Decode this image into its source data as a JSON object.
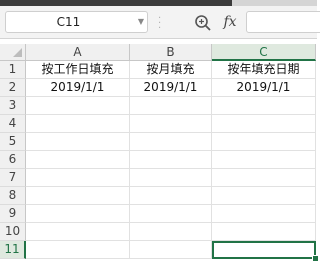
{
  "formula_bar": {
    "name_box": "C11",
    "fx_label": "fx",
    "formula_value": ""
  },
  "columns": [
    "A",
    "B",
    "C"
  ],
  "active_column": "C",
  "active_row": 11,
  "rows": [
    {
      "num": "1",
      "cells": [
        "按工作日填充",
        "按月填充",
        "按年填充日期"
      ]
    },
    {
      "num": "2",
      "cells": [
        "2019/1/1",
        "2019/1/1",
        "2019/1/1"
      ]
    },
    {
      "num": "3",
      "cells": [
        "",
        "",
        ""
      ]
    },
    {
      "num": "4",
      "cells": [
        "",
        "",
        ""
      ]
    },
    {
      "num": "5",
      "cells": [
        "",
        "",
        ""
      ]
    },
    {
      "num": "6",
      "cells": [
        "",
        "",
        ""
      ]
    },
    {
      "num": "7",
      "cells": [
        "",
        "",
        ""
      ]
    },
    {
      "num": "8",
      "cells": [
        "",
        "",
        ""
      ]
    },
    {
      "num": "9",
      "cells": [
        "",
        "",
        ""
      ]
    },
    {
      "num": "10",
      "cells": [
        "",
        "",
        ""
      ]
    },
    {
      "num": "11",
      "cells": [
        "",
        "",
        ""
      ]
    }
  ],
  "colors": {
    "accent": "#217346",
    "header_bg": "#f0f0f0",
    "active_header_bg": "#dfe9df"
  }
}
